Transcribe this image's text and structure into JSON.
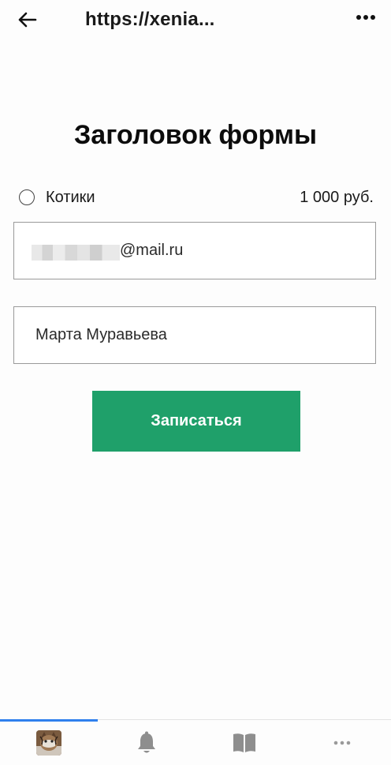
{
  "topbar": {
    "url": "https://xenia...",
    "back_icon": "arrow-left-icon",
    "menu_icon": "more-horizontal-icon"
  },
  "form": {
    "title": "Заголовок формы",
    "option": {
      "label": "Котики",
      "price": "1 000 руб.",
      "selected": false
    },
    "email": {
      "value_suffix": "@mail.ru",
      "value_redacted": true
    },
    "name": {
      "value": "Марта Муравьева"
    },
    "submit_label": "Записаться"
  },
  "bottom_nav": {
    "items": [
      {
        "icon": "avatar",
        "active": true
      },
      {
        "icon": "bell-icon",
        "active": false
      },
      {
        "icon": "book-icon",
        "active": false
      },
      {
        "icon": "more-horizontal-icon",
        "active": false
      }
    ]
  },
  "colors": {
    "accent_button": "#1fa06a",
    "active_tab_indicator": "#2f80ed",
    "border": "#9a9a9a",
    "icon_gray": "#8e8e8e"
  }
}
